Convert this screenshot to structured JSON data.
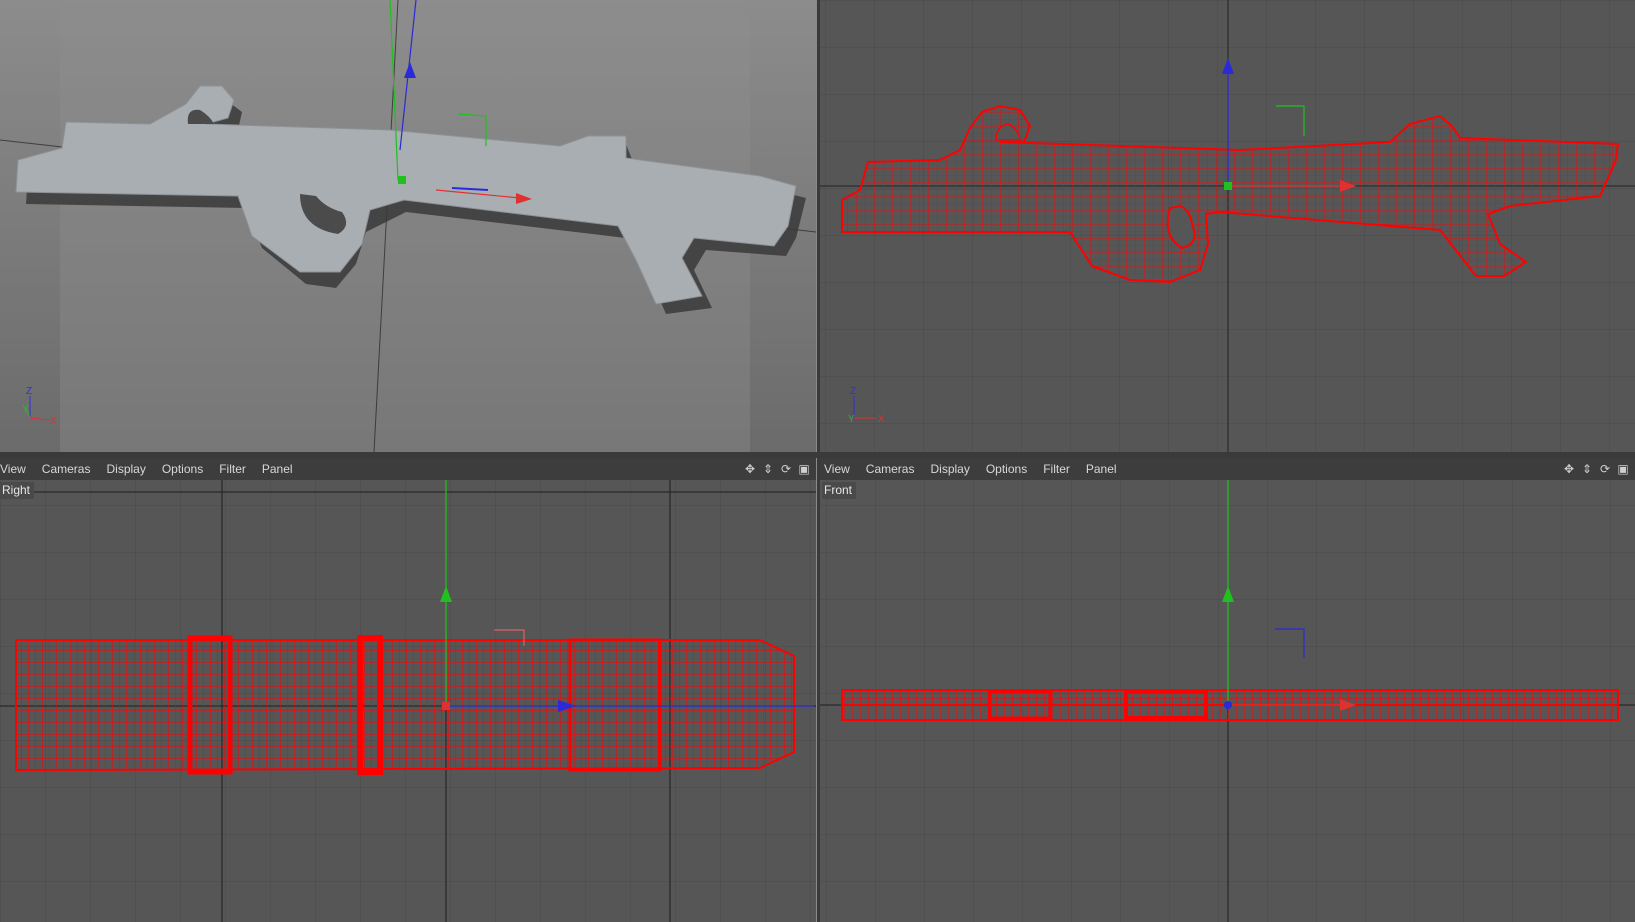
{
  "viewports": {
    "perspective": {
      "axis_labels": {
        "z": "Z",
        "y": "Y",
        "x": "X"
      }
    },
    "top": {
      "axis_labels": {
        "z": "Z",
        "y": "Y",
        "x": "X"
      }
    },
    "right": {
      "label": "Right",
      "menu": [
        "View",
        "Cameras",
        "Display",
        "Options",
        "Filter",
        "Panel"
      ],
      "tools": [
        "move-icon",
        "pan-icon",
        "rotate-icon",
        "maximize-icon"
      ]
    },
    "front": {
      "label": "Front",
      "menu": [
        "View",
        "Cameras",
        "Display",
        "Options",
        "Filter",
        "Panel"
      ],
      "tools": [
        "move-icon",
        "pan-icon",
        "rotate-icon",
        "maximize-icon"
      ]
    }
  },
  "colors": {
    "wireframe": "#ff0000",
    "axis_x": "#e03030",
    "axis_y": "#20c020",
    "axis_z": "#3030e0",
    "grid": "#4a4a4a",
    "model_solid": "#a8adb2"
  }
}
